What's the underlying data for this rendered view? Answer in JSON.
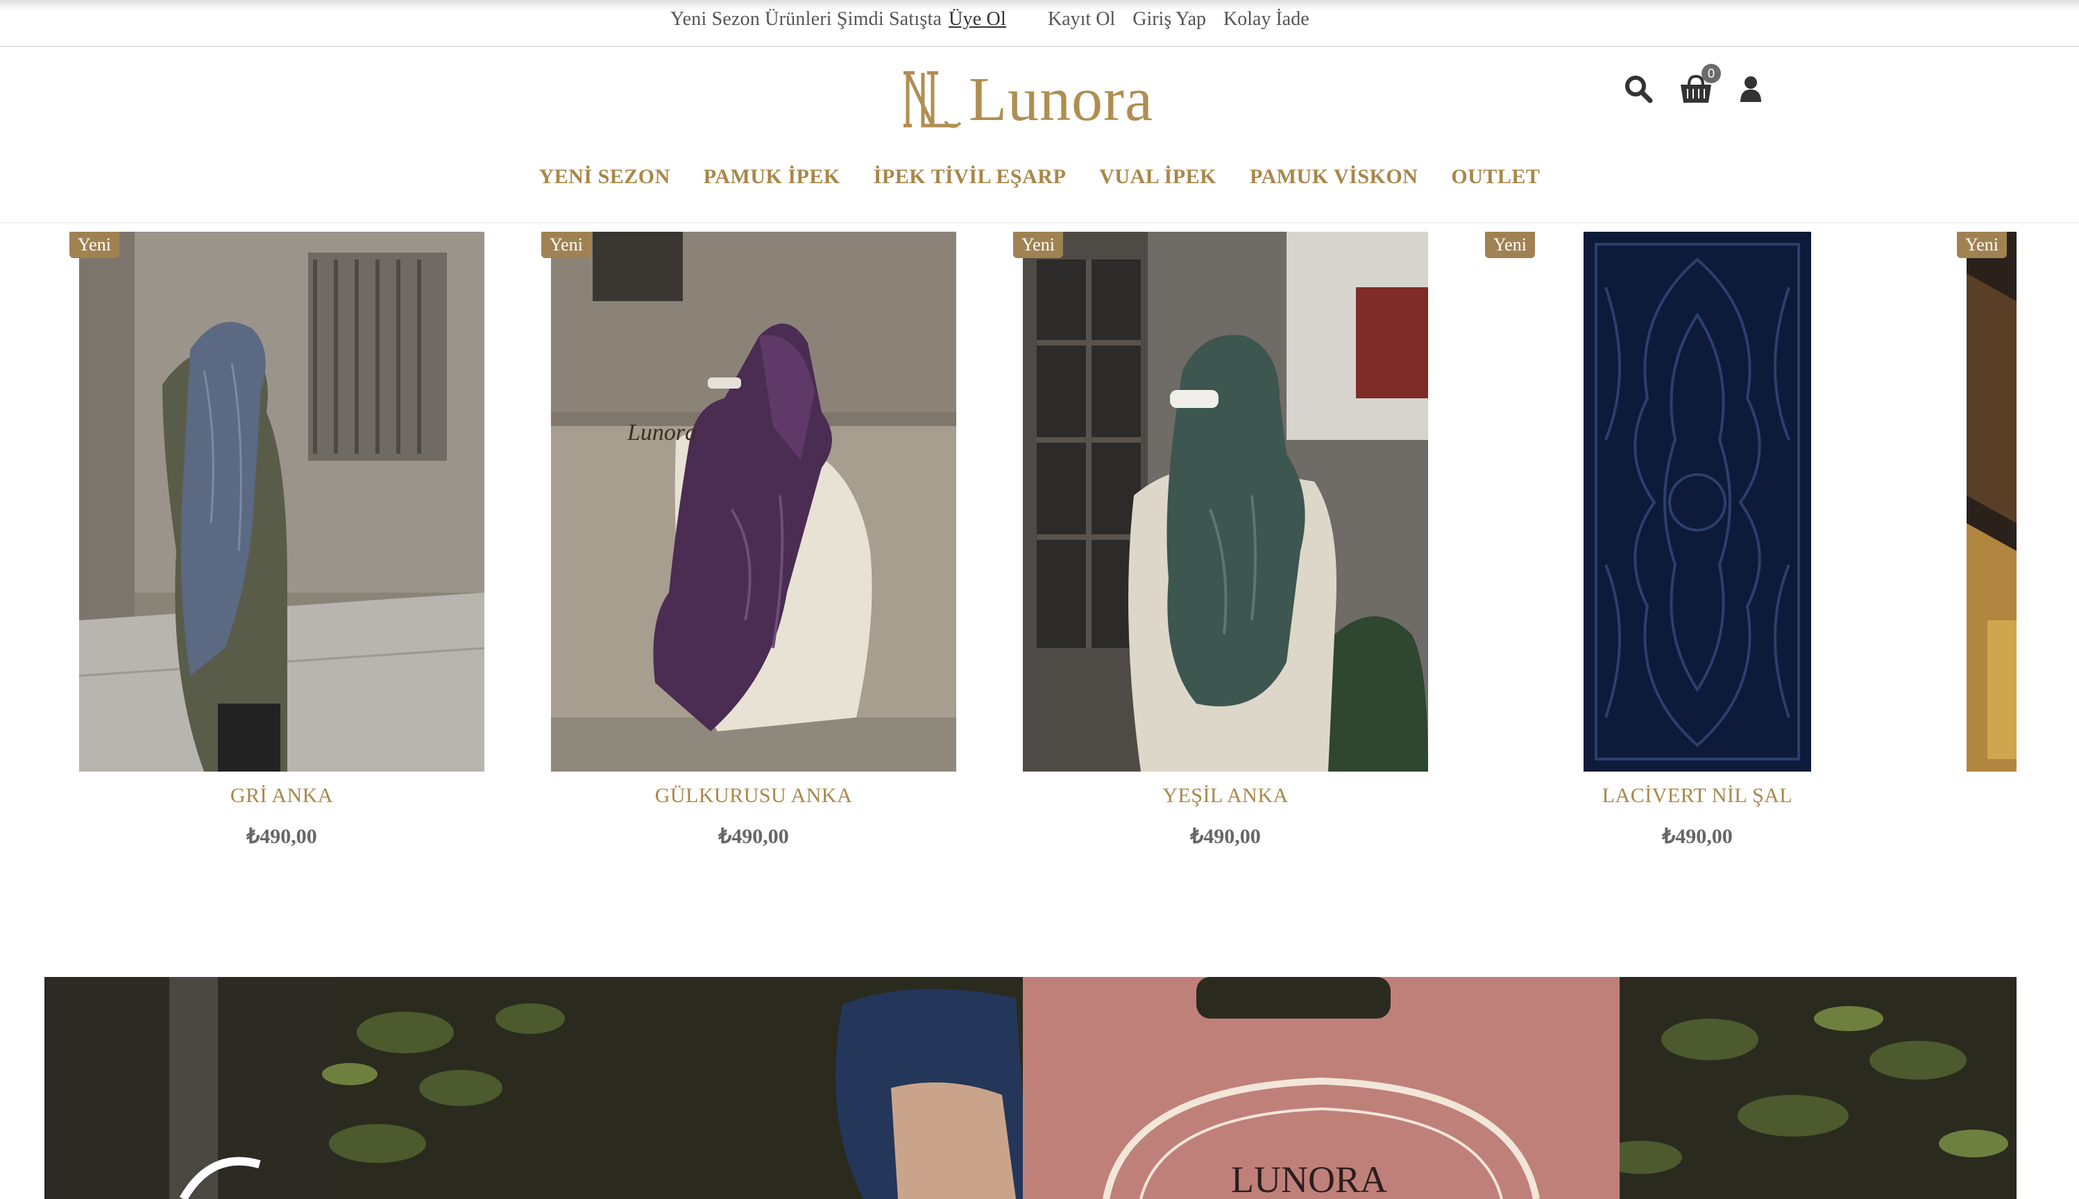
{
  "topbar": {
    "announcement": "Yeni Sezon Ürünleri Şimdi Satışta",
    "announcement_link": "Üye Ol",
    "links": [
      "Kayıt Ol",
      "Giriş Yap",
      "Kolay İade"
    ]
  },
  "header": {
    "brand": "Lunora",
    "cart_count": "0",
    "icons": [
      "search-icon",
      "cart-icon",
      "user-icon"
    ]
  },
  "nav": [
    "YENİ SEZON",
    "PAMUK İPEK",
    "İPEK TİVİL EŞARP",
    "VUAL İPEK",
    "PAMUK VİSKON",
    "OUTLET"
  ],
  "products": [
    {
      "badge": "Yeni",
      "name": "GRİ ANKA",
      "price": "₺490,00"
    },
    {
      "badge": "Yeni",
      "name": "GÜLKURUSU ANKA",
      "price": "₺490,00"
    },
    {
      "badge": "Yeni",
      "name": "YEŞİL ANKA",
      "price": "₺490,00"
    },
    {
      "badge": "Yeni",
      "name": "LACİVERT NİL ŞAL",
      "price": "₺490,00"
    },
    {
      "badge": "Yeni",
      "name": "",
      "price": ""
    }
  ],
  "colors": {
    "brand_gold": "#b08e52",
    "badge_bg": "#a08252",
    "navy_scarf": "#0e1a3a"
  }
}
